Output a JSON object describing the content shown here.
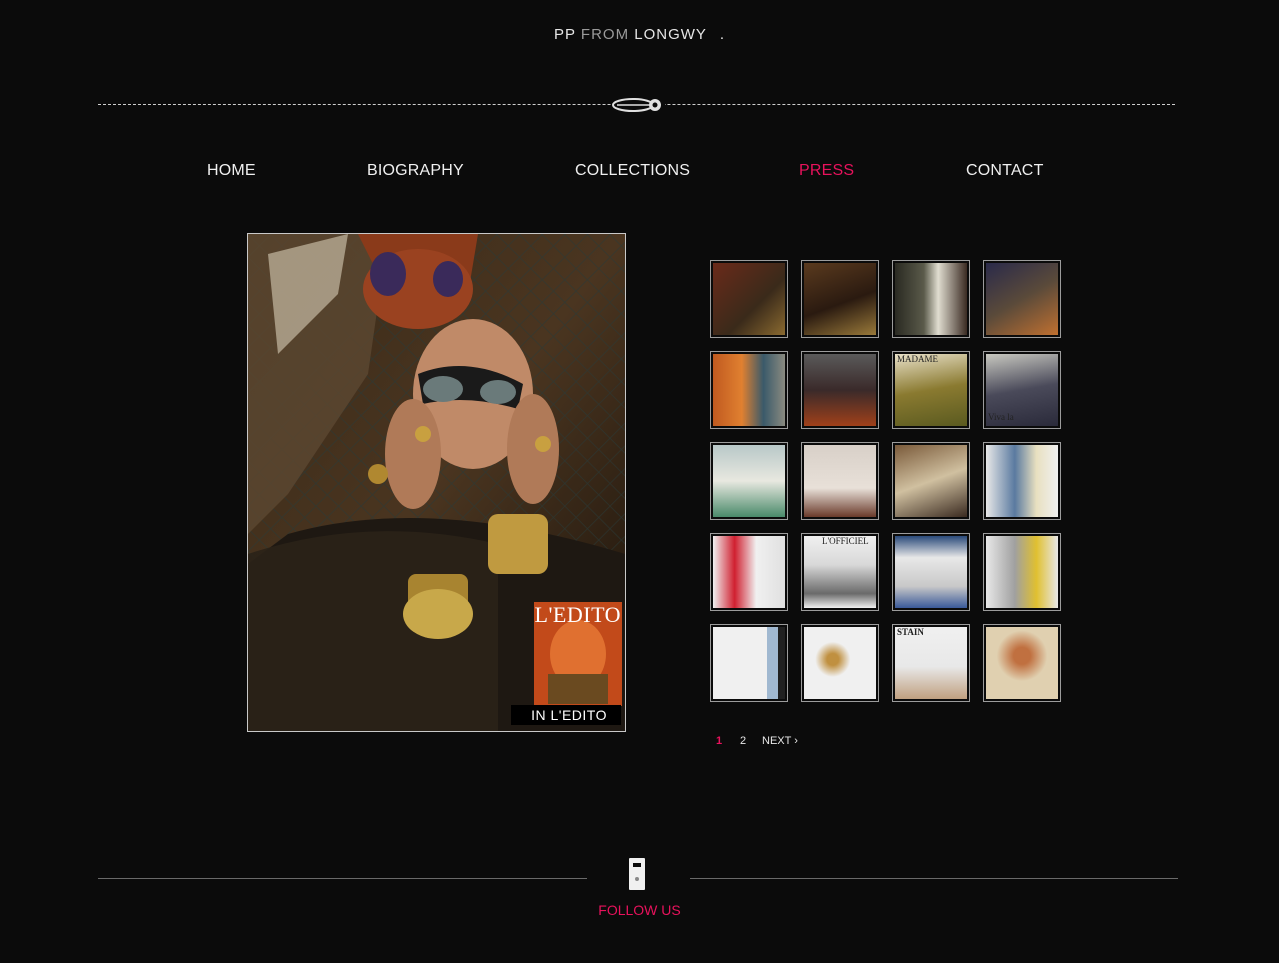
{
  "header": {
    "logo_pp": "PP",
    "logo_from": "FROM",
    "logo_longwy": "LONGWY",
    "logo_dot": "."
  },
  "nav": {
    "items": [
      {
        "label": "HOME",
        "active": false
      },
      {
        "label": "BIOGRAPHY",
        "active": false
      },
      {
        "label": "COLLECTIONS",
        "active": false
      },
      {
        "label": "PRESS",
        "active": true
      },
      {
        "label": "CONTACT",
        "active": false
      }
    ]
  },
  "feature": {
    "caption": "IN L'EDITO",
    "magazine_label": "L'EDITO"
  },
  "thumbnails": [
    {
      "label": ""
    },
    {
      "label": ""
    },
    {
      "label": ""
    },
    {
      "label": ""
    },
    {
      "label": ""
    },
    {
      "label": ""
    },
    {
      "label": "MADAME"
    },
    {
      "label": "Viva la"
    },
    {
      "label": ""
    },
    {
      "label": ""
    },
    {
      "label": ""
    },
    {
      "label": ""
    },
    {
      "label": ""
    },
    {
      "label": "L'OFFICIEL"
    },
    {
      "label": ""
    },
    {
      "label": ""
    },
    {
      "label": ""
    },
    {
      "label": ""
    },
    {
      "label": "STAIN"
    },
    {
      "label": ""
    }
  ],
  "pagination": {
    "pages": [
      "1",
      "2"
    ],
    "current": "1",
    "next": "NEXT ›"
  },
  "footer": {
    "follow_label": "FOLLOW US"
  },
  "colors": {
    "background": "#0b0b0b",
    "accent": "#e8125c",
    "text": "#f0f0f0"
  }
}
